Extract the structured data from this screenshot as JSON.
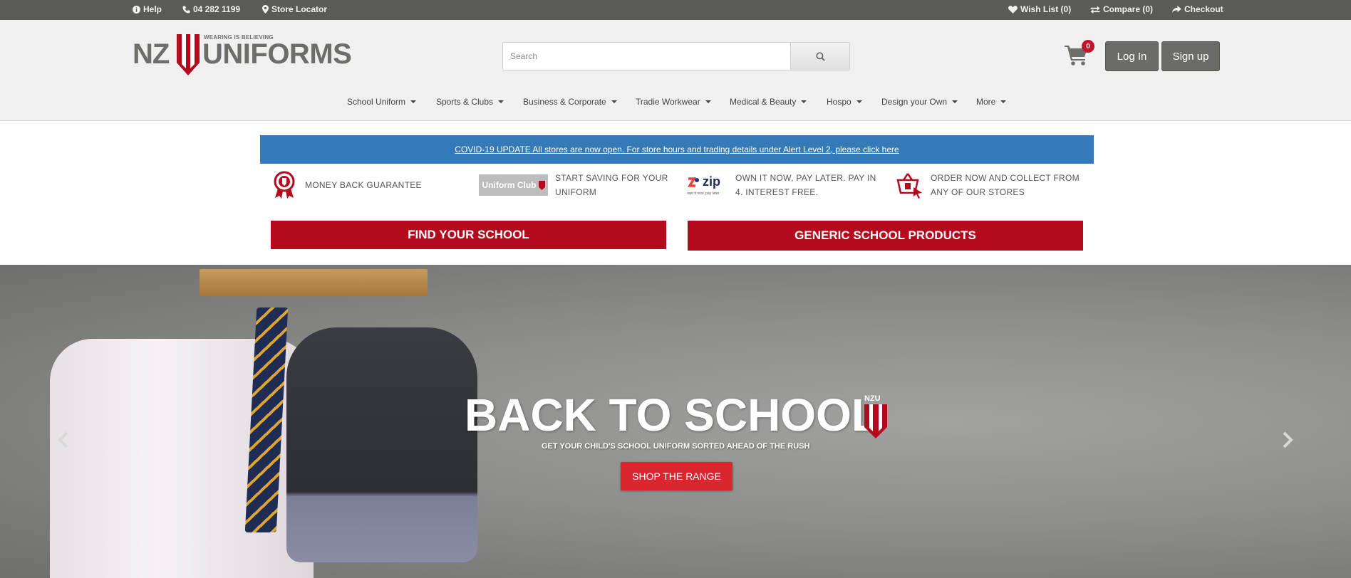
{
  "topbar": {
    "help": "Help",
    "phone": "04 282 1199",
    "store_locator": "Store Locator",
    "wishlist": "Wish List (0)",
    "compare": "Compare (0)",
    "checkout": "Checkout"
  },
  "logo": {
    "nz": "NZ",
    "uniforms": "UNIFORMS",
    "tagline": "WEARING IS BELIEVING"
  },
  "search": {
    "placeholder": "Search"
  },
  "cart": {
    "count": "0"
  },
  "auth": {
    "login": "Log In",
    "signup": "Sign up"
  },
  "nav": [
    {
      "label": "School Uniform"
    },
    {
      "label": "Sports & Clubs"
    },
    {
      "label": "Business & Corporate"
    },
    {
      "label": "Tradie Workwear"
    },
    {
      "label": "Medical & Beauty"
    },
    {
      "label": "Hospo"
    },
    {
      "label": "Design your Own"
    },
    {
      "label": "More"
    }
  ],
  "covid_banner": "COVID-19 UPDATE All stores are now open. For store hours and trading details under Alert Level 2, please click here",
  "features": [
    {
      "icon": "ribbon-badge-icon",
      "text": "MONEY BACK GUARANTEE"
    },
    {
      "icon": "uniform-club-logo",
      "logo_text": "Uniform Club",
      "text_line1": "START SAVING FOR YOUR",
      "text_line2": "UNIFORM"
    },
    {
      "icon": "zip-logo",
      "logo_text": "zip",
      "logo_small": "own it now, pay later",
      "text_line1": "OWN IT NOW, PAY LATER. PAY IN",
      "text_line2": "4. INTEREST FREE."
    },
    {
      "icon": "basket-cursor-icon",
      "text_line1": "ORDER NOW AND COLLECT FROM",
      "text_line2": "ANY OF OUR STORES"
    }
  ],
  "cta_buttons": {
    "find_school": "FIND YOUR SCHOOL",
    "generic_products": "GENERIC SCHOOL PRODUCTS"
  },
  "hero": {
    "title": "BACK TO SCHOOL",
    "badge": "NZU",
    "subtitle": "GET YOUR CHILD'S SCHOOL UNIFORM SORTED AHEAD OF THE RUSH",
    "cta": "SHOP THE RANGE"
  },
  "colors": {
    "brand_red": "#b40a1e",
    "topbar": "#5a5b56",
    "banner_blue": "#337ab7",
    "cta_red": "#d9262f"
  }
}
